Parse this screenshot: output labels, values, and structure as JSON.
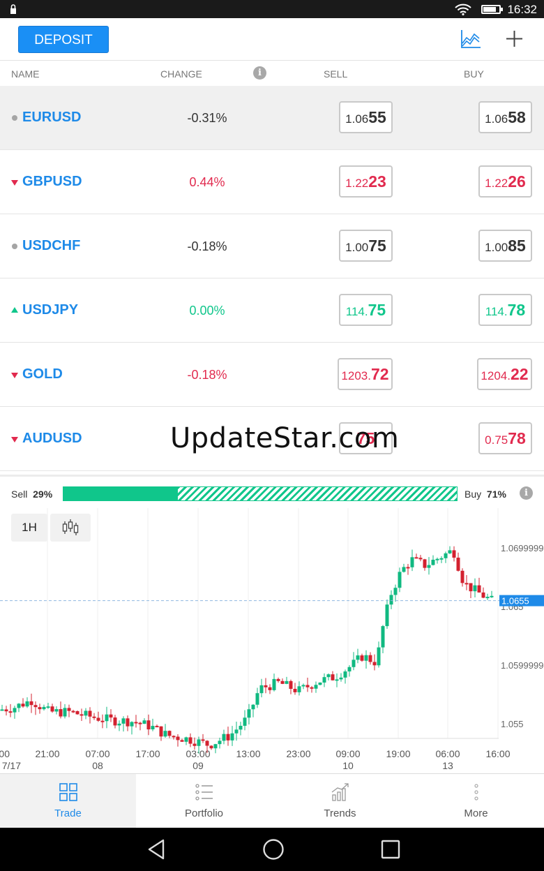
{
  "status_bar": {
    "time": "16:32"
  },
  "toolbar": {
    "deposit_label": "DEPOSIT"
  },
  "columns": {
    "name": "NAME",
    "change": "CHANGE",
    "info": "i",
    "sell": "SELL",
    "buy": "BUY"
  },
  "instruments": [
    {
      "name": "EURUSD",
      "trend": "neutral",
      "change": "-0.31%",
      "sell_small": "1.06",
      "sell_big": "55",
      "buy_small": "1.06",
      "buy_big": "58"
    },
    {
      "name": "GBPUSD",
      "trend": "down",
      "change": "0.44%",
      "sell_small": "1.22",
      "sell_big": "23",
      "buy_small": "1.22",
      "buy_big": "26"
    },
    {
      "name": "USDCHF",
      "trend": "neutral",
      "change": "-0.18%",
      "sell_small": "1.00",
      "sell_big": "75",
      "buy_small": "1.00",
      "buy_big": "85"
    },
    {
      "name": "USDJPY",
      "trend": "up",
      "change": "0.00%",
      "sell_small": "114.",
      "sell_big": "75",
      "buy_small": "114.",
      "buy_big": "78"
    },
    {
      "name": "GOLD",
      "trend": "down",
      "change": "-0.18%",
      "sell_small": "1203.",
      "sell_big": "72",
      "buy_small": "1204.",
      "buy_big": "22"
    },
    {
      "name": "AUDUSD",
      "trend": "down",
      "change": "",
      "sell_small": "",
      "sell_big": "75",
      "buy_small": "0.75",
      "buy_big": "78"
    }
  ],
  "watermark": "UpdateStar.com",
  "sentiment": {
    "sell_label": "Sell",
    "sell_pct": "29%",
    "sell_fraction": 0.29,
    "buy_label": "Buy",
    "buy_pct": "71%"
  },
  "chart": {
    "timeframe": "1H",
    "current_price": "1.0655",
    "y_labels": [
      "1.0699999",
      "1.065",
      "1.0599999",
      "1.055"
    ],
    "x_labels": [
      {
        "time": "00",
        "date": "7/17"
      },
      {
        "time": "21:00",
        "date": ""
      },
      {
        "time": "07:00",
        "date": "08"
      },
      {
        "time": "17:00",
        "date": ""
      },
      {
        "time": "03:00",
        "date": "09"
      },
      {
        "time": "13:00",
        "date": ""
      },
      {
        "time": "23:00",
        "date": ""
      },
      {
        "time": "09:00",
        "date": "10"
      },
      {
        "time": "19:00",
        "date": ""
      },
      {
        "time": "06:00",
        "date": "13"
      },
      {
        "time": "16:00",
        "date": ""
      }
    ],
    "colors": {
      "up": "#10b981",
      "down": "#d3212f",
      "price_tag": "#1e8ae8"
    }
  },
  "nav": [
    {
      "label": "Trade",
      "icon": "grid-icon"
    },
    {
      "label": "Portfolio",
      "icon": "list-icon"
    },
    {
      "label": "Trends",
      "icon": "trends-icon"
    },
    {
      "label": "More",
      "icon": "more-icon"
    }
  ]
}
